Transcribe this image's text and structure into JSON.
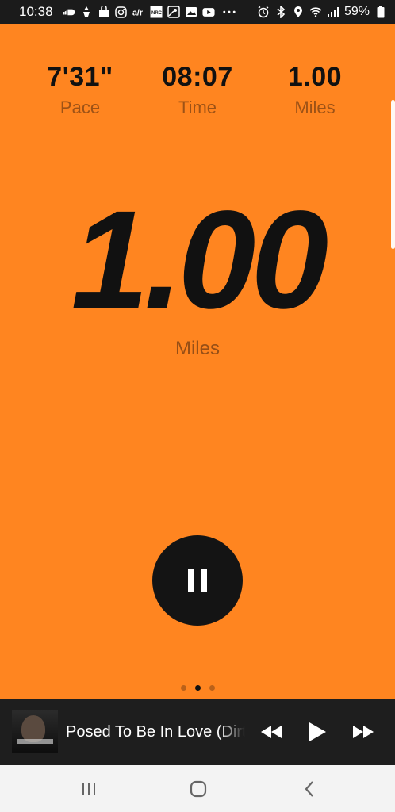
{
  "status_bar": {
    "time": "10:38",
    "left_icons": [
      "soundcloud-icon",
      "app-icon",
      "shopping-bag-icon",
      "instagram-icon",
      "airtel-icon",
      "nrc-icon",
      "maps-icon",
      "gallery-icon",
      "youtube-icon",
      "more-dots-icon"
    ],
    "right_icons": [
      "alarm-icon",
      "bluetooth-icon",
      "location-icon",
      "wifi-icon",
      "signal-icon",
      "battery-icon"
    ],
    "battery_percent": "59%"
  },
  "stats": [
    {
      "value": "7'31\"",
      "label": "Pace"
    },
    {
      "value": "08:07",
      "label": "Time"
    },
    {
      "value": "1.00",
      "label": "Miles"
    }
  ],
  "main_metric": {
    "value": "1.00",
    "label": "Miles"
  },
  "pager": {
    "count": 3,
    "active": 1
  },
  "music": {
    "track_title": "Posed To Be In Love (Dirty)"
  },
  "colors": {
    "background": "#FF8520",
    "text": "#111111",
    "label": "#8C4A15",
    "music_bar": "#1E1E1E",
    "nav_bar": "#F3F3F3"
  }
}
